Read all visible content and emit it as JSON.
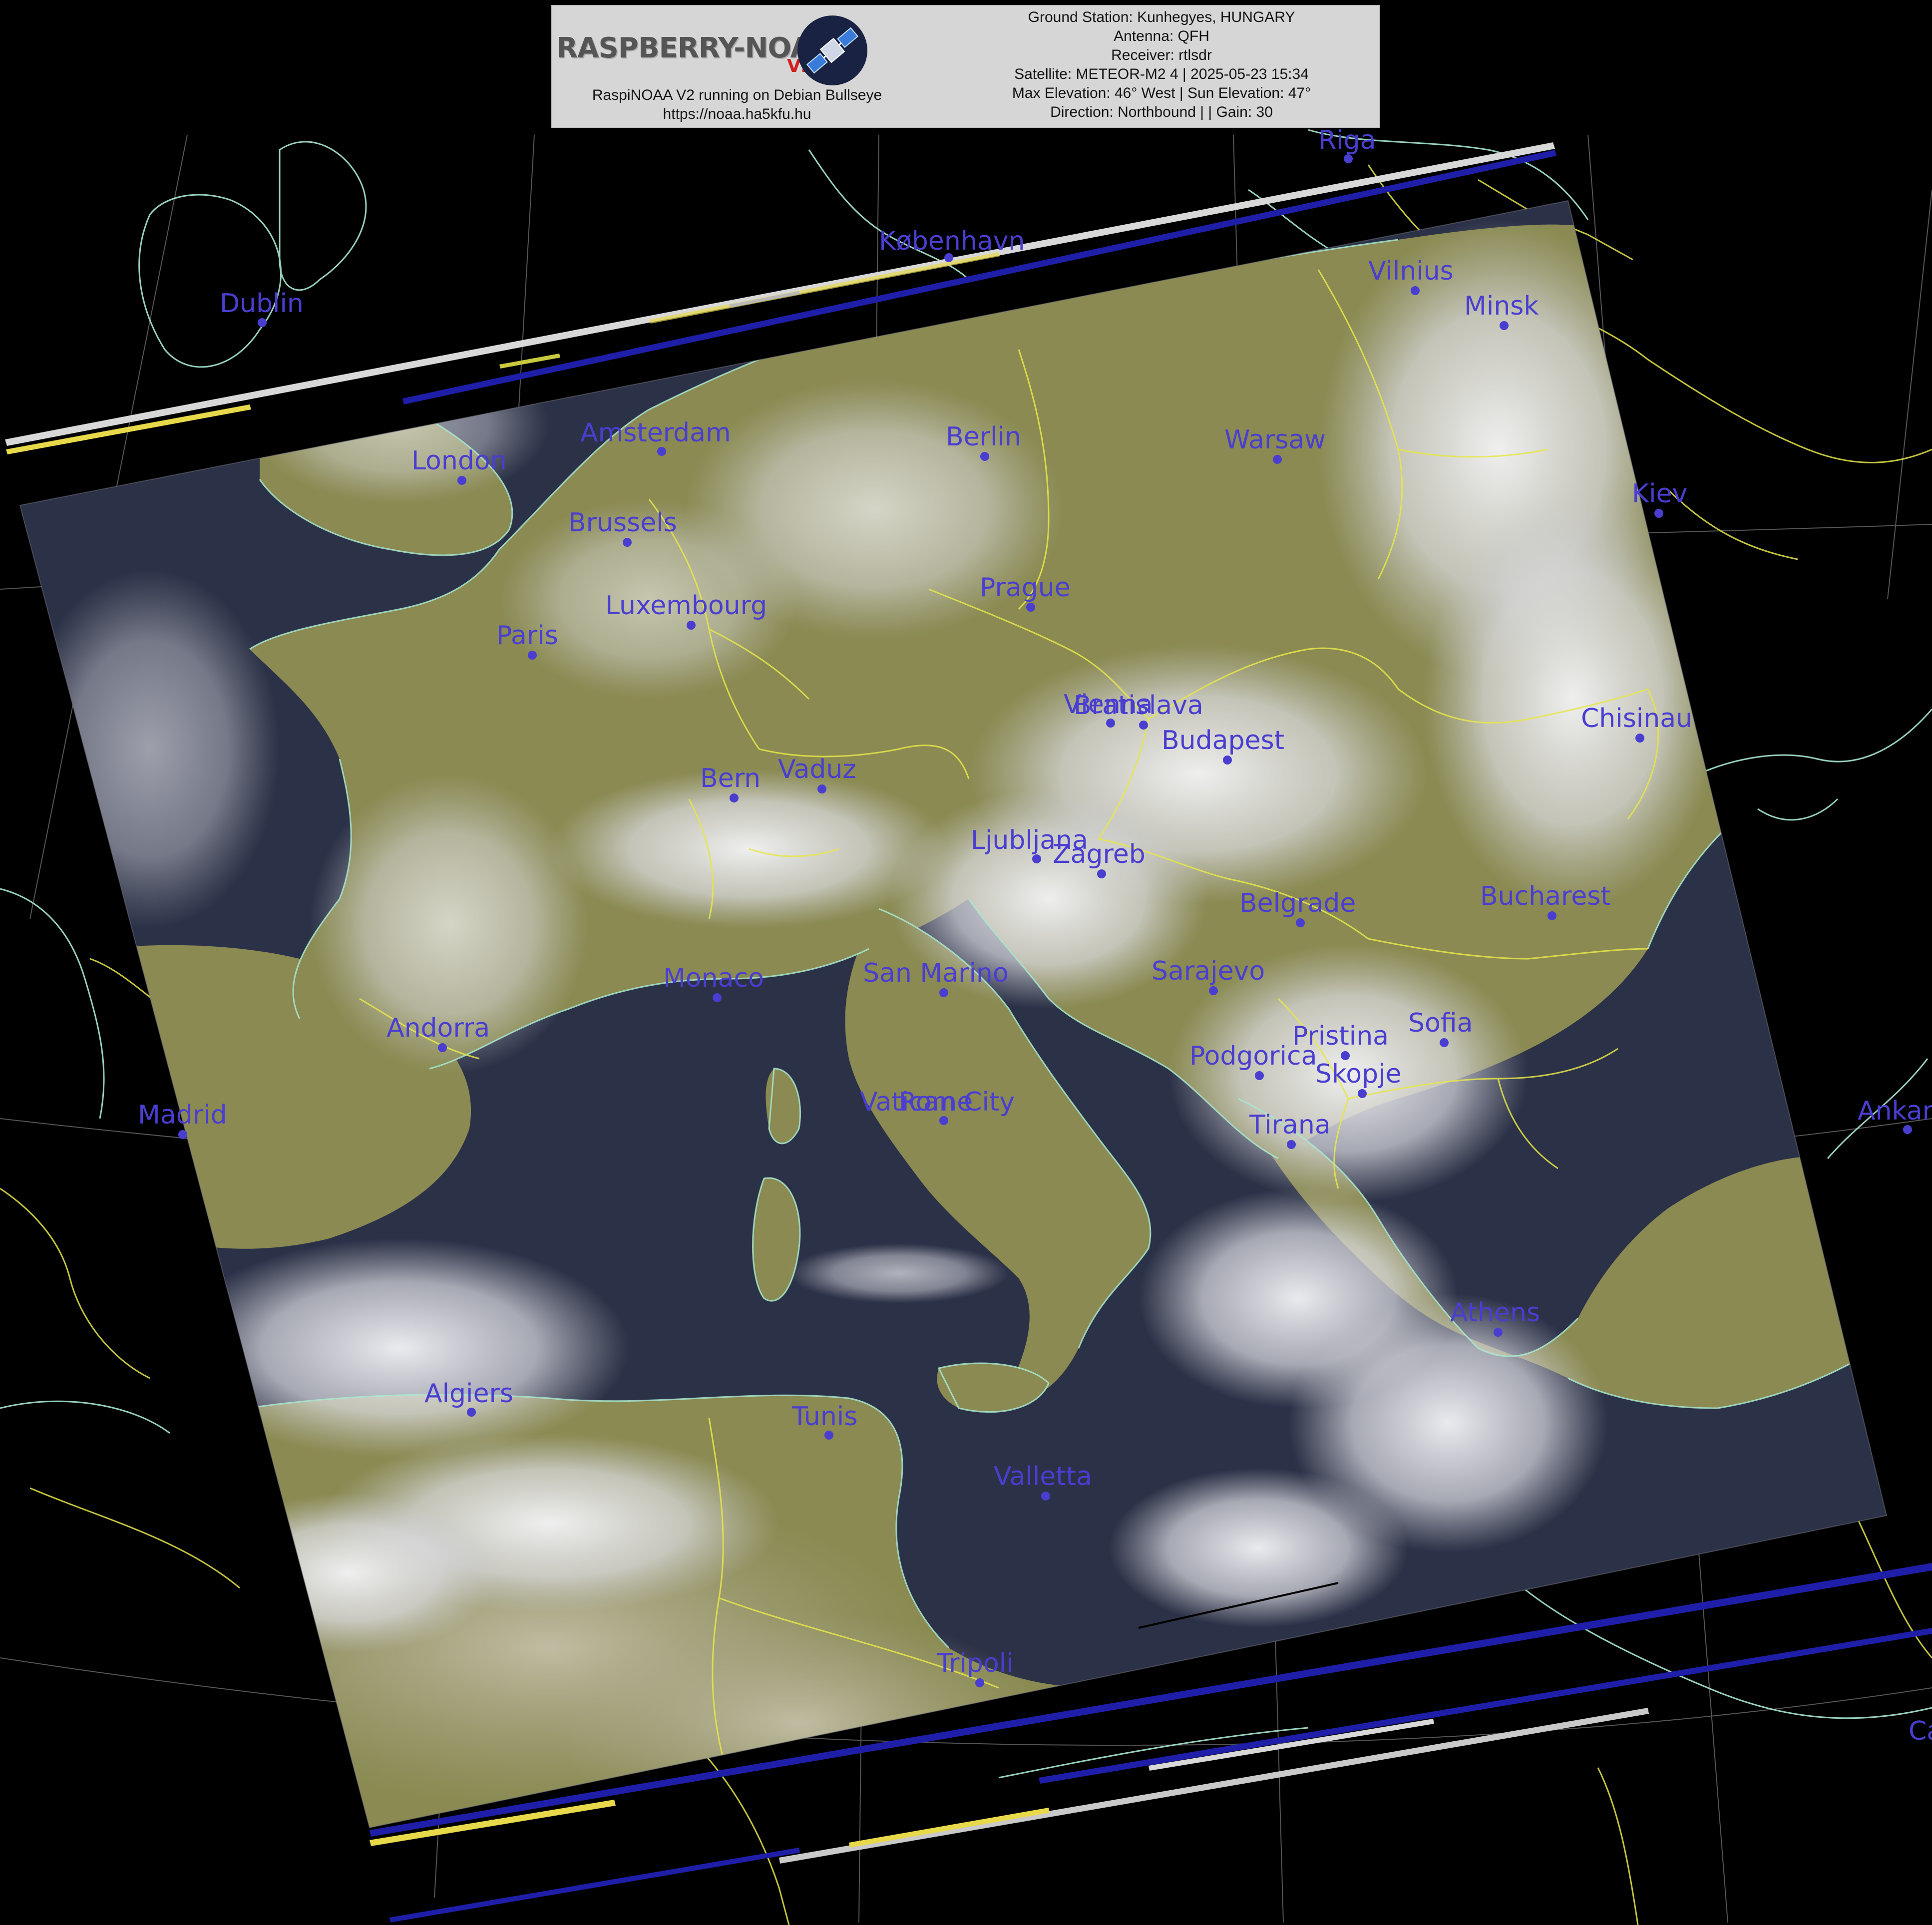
{
  "header": {
    "logo_text": "RASPBERRY-NOAA",
    "logo_badge": "V2",
    "caption_line1": "RaspiNOAA V2 running on Debian Bullseye",
    "caption_line2": "https://noaa.ha5kfu.hu",
    "info_lines": [
      "Ground Station: Kunhegyes, HUNGARY",
      "Antenna: QFH",
      "Receiver: rtlsdr",
      "Satellite: METEOR-M2 4 | 2025-05-23 15:34",
      "Max Elevation: 46° West | Sun Elevation: 47°",
      "Direction: Northbound | | Gain: 30"
    ]
  },
  "cities": [
    {
      "name": "Riga"
    },
    {
      "name": "København"
    },
    {
      "name": "Vilnius"
    },
    {
      "name": "Minsk"
    },
    {
      "name": "Dublin"
    },
    {
      "name": "Amsterdam"
    },
    {
      "name": "Berlin"
    },
    {
      "name": "Warsaw"
    },
    {
      "name": "London"
    },
    {
      "name": "Kiev"
    },
    {
      "name": "Brussels"
    },
    {
      "name": "Prague"
    },
    {
      "name": "Luxembourg"
    },
    {
      "name": "Paris"
    },
    {
      "name": "Vienna"
    },
    {
      "name": "Bratislava"
    },
    {
      "name": "Chisinau"
    },
    {
      "name": "Budapest"
    },
    {
      "name": "Bern"
    },
    {
      "name": "Vaduz"
    },
    {
      "name": "Ljubljana"
    },
    {
      "name": "Zagreb"
    },
    {
      "name": "Belgrade"
    },
    {
      "name": "Bucharest"
    },
    {
      "name": "Monaco"
    },
    {
      "name": "San Marino"
    },
    {
      "name": "Sarajevo"
    },
    {
      "name": "Andorra"
    },
    {
      "name": "Pristina"
    },
    {
      "name": "Sofia"
    },
    {
      "name": "Podgorica"
    },
    {
      "name": "Skopje"
    },
    {
      "name": "Madrid"
    },
    {
      "name": "Vatican City"
    },
    {
      "name": "Rome"
    },
    {
      "name": "Tirana"
    },
    {
      "name": "Ankara"
    },
    {
      "name": "Athens"
    },
    {
      "name": "Algiers"
    },
    {
      "name": "Tunis"
    },
    {
      "name": "Valletta"
    },
    {
      "name": "Tripoli"
    },
    {
      "name": "Cairo"
    }
  ],
  "colors": {
    "background": "#000000",
    "city_label": "#4a3ed0",
    "border_line": "#e6e64a",
    "coastline": "#a8e8d0",
    "land": "#8a8a52",
    "sea": "#2a3048",
    "cloud": "#e8e8ee"
  }
}
